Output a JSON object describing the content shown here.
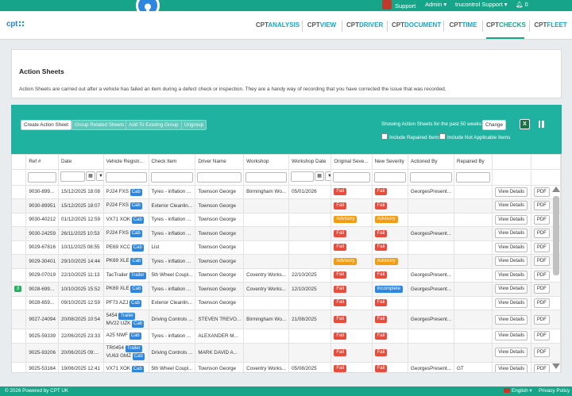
{
  "topbar": {
    "support": "Support",
    "admin": "Admin",
    "account": "trucontrol Support",
    "notifications": "0"
  },
  "logo": "cpt",
  "nav": [
    {
      "pre": "CPT",
      "suf": "ANALYSIS"
    },
    {
      "pre": "CPT",
      "suf": "VIEW"
    },
    {
      "pre": "CPT",
      "suf": "DRIVER"
    },
    {
      "pre": "CPT",
      "suf": "DOCUMENT"
    },
    {
      "pre": "CPT",
      "suf": "TIME"
    },
    {
      "pre": "CPT",
      "suf": "CHECKS"
    },
    {
      "pre": "CPT",
      "suf": "FLEET"
    }
  ],
  "page": {
    "title": "Action Sheets",
    "description": "Action Sheets are carried out after a vehicle has failed an item during a defect check or inspection. They are a handy way of recording that you have corrected the issue that was recorded."
  },
  "toolbar": {
    "create": "Create Action Sheet",
    "group": "Group Related Sheets",
    "add": "Add To Existing Group",
    "ungroup": "Ungroup",
    "showing": "Showing Action Sheets for the past 50 weeks",
    "change": "Change",
    "include_repaired": "Include Repaired Items",
    "include_na": "Include Not Applicable Items"
  },
  "columns": [
    "Ref #",
    "Date",
    "Vehicle Registr...",
    "Check Item",
    "Driver Name",
    "Workshop",
    "Workshop Date",
    "Original Seve...",
    "New Severity",
    "Actioned By",
    "Repaired By"
  ],
  "rows": [
    {
      "ref": "9030-899...",
      "date": "15/12/2025 18:08",
      "reg": "PJ24 FXS",
      "tag": "Cab",
      "tag2": "",
      "reg2": "",
      "item": "Tyres - inflation ...",
      "driver": "Townson George",
      "workshop": "Birmingham Wo...",
      "wdate": "05/01/2026",
      "orig": "Fail",
      "new": "Fail",
      "actioned": "GeorgesPresent...",
      "repaired": ""
    },
    {
      "ref": "9030-89951",
      "date": "15/12/2025 18:07",
      "reg": "PJ24 FXS",
      "tag": "Cab",
      "tag2": "",
      "reg2": "",
      "item": "Exterior Cleanlin...",
      "driver": "Townson George",
      "workshop": "",
      "wdate": "",
      "orig": "Fail",
      "new": "Fail",
      "actioned": "",
      "repaired": ""
    },
    {
      "ref": "9030-40212",
      "date": "01/12/2025 12:59",
      "reg": "VX71 XOK",
      "tag": "Cab",
      "tag2": "",
      "reg2": "",
      "item": "Tyres - inflation ...",
      "driver": "Townson George",
      "workshop": "",
      "wdate": "",
      "orig": "Advisory",
      "new": "Advisory",
      "actioned": "",
      "repaired": ""
    },
    {
      "ref": "9030-24259",
      "date": "26/11/2025 10:53",
      "reg": "PJ24 FXS",
      "tag": "Cab",
      "tag2": "",
      "reg2": "",
      "item": "Tyres - inflation ...",
      "driver": "Townson George",
      "workshop": "",
      "wdate": "",
      "orig": "Fail",
      "new": "Fail",
      "actioned": "GeorgesPresent...",
      "repaired": ""
    },
    {
      "ref": "9029-67816",
      "date": "10/11/2025 08:55",
      "reg": "PE69 XCC",
      "tag": "Cab",
      "tag2": "",
      "reg2": "",
      "item": "List",
      "driver": "Townson George",
      "workshop": "",
      "wdate": "",
      "orig": "Fail",
      "new": "Fail",
      "actioned": "",
      "repaired": ""
    },
    {
      "ref": "9029-30401",
      "date": "29/10/2025 14:44",
      "reg": "PK69 XLE",
      "tag": "Cab",
      "tag2": "",
      "reg2": "",
      "item": "Tyres - inflation ...",
      "driver": "Townson George",
      "workshop": "",
      "wdate": "",
      "orig": "Advisory",
      "new": "Advisory",
      "actioned": "",
      "repaired": ""
    },
    {
      "ref": "9029-07019",
      "date": "22/10/2025 11:13",
      "reg": "TacTrailer",
      "tag": "Trailer",
      "tag2": "",
      "reg2": "",
      "item": "5th Wheel Coupl...",
      "driver": "Townson George",
      "workshop": "Coventry Works...",
      "wdate": "22/10/2025",
      "orig": "Fail",
      "new": "Fail",
      "actioned": "GeorgesPresent...",
      "repaired": ""
    },
    {
      "ref": "9028-699...",
      "badge": "3",
      "date": "10/10/2025 15:52",
      "reg": "PK69 XLE",
      "tag": "Cab",
      "tag2": "",
      "reg2": "",
      "item": "Tyres - inflation ...",
      "driver": "Townson George",
      "workshop": "Coventry Works...",
      "wdate": "12/10/2025",
      "orig": "Fail",
      "new": "Incomplete",
      "actioned": "GeorgesPresent...",
      "repaired": ""
    },
    {
      "ref": "9028-659...",
      "date": "09/10/2025 12:59",
      "reg": "PF73 AZJ",
      "tag": "Cab",
      "tag2": "",
      "reg2": "",
      "item": "Exterior Cleanlin...",
      "driver": "Townson George",
      "workshop": "",
      "wdate": "",
      "orig": "Fail",
      "new": "Fail",
      "actioned": "",
      "repaired": ""
    },
    {
      "ref": "9027-24094",
      "date": "20/08/2025 10:54",
      "reg": "5454",
      "tag": "Trailer",
      "reg2": "MV22 UZK",
      "tag2": "Cab",
      "item": "Driving Controls ...",
      "driver": "STEVEN TREVO...",
      "workshop": "Birmingham Wo...",
      "wdate": "21/08/2025",
      "orig": "Fail",
      "new": "Fail",
      "actioned": "GeorgesPresent...",
      "repaired": ""
    },
    {
      "ref": "9025-59339",
      "date": "22/06/2025 23:33",
      "reg": "A25 NWF",
      "tag": "Cab",
      "tag2": "",
      "reg2": "",
      "item": "Tyres - inflation ...",
      "driver": "ALEXANDER M...",
      "workshop": "",
      "wdate": "",
      "orig": "Fail",
      "new": "Fail",
      "actioned": "",
      "repaired": ""
    },
    {
      "ref": "9025-93206",
      "date": "20/06/2025 09:...",
      "reg": "TR0454",
      "tag": "Trailer",
      "reg2": "VU63 GMZ",
      "tag2": "Cab",
      "item": "Driving Controls ...",
      "driver": "MARK DAVID A...",
      "workshop": "",
      "wdate": "",
      "orig": "Fail",
      "new": "Fail",
      "actioned": "",
      "repaired": ""
    },
    {
      "ref": "9025-53164",
      "date": "19/06/2025 12:41",
      "reg": "VX71 XOK",
      "tag": "Cab",
      "tag2": "",
      "reg2": "",
      "item": "5th Wheel Coupl...",
      "driver": "Townson George",
      "workshop": "Coventry Works...",
      "wdate": "05/08/2025",
      "orig": "Fail",
      "new": "Fail",
      "actioned": "GeorgesPresent...",
      "repaired": "GT"
    }
  ],
  "row_actions": {
    "view": "View Details",
    "pdf": "PDF"
  },
  "footer": {
    "copyright": "© 2026 Powered by CPT UK",
    "language": "English",
    "privacy": "Privacy Policy"
  },
  "colors": {
    "brand": "#17a589",
    "toolbar": "#20b2a0",
    "fail": "#e74c3c",
    "advisory": "#f39c12",
    "info": "#2e86de"
  }
}
